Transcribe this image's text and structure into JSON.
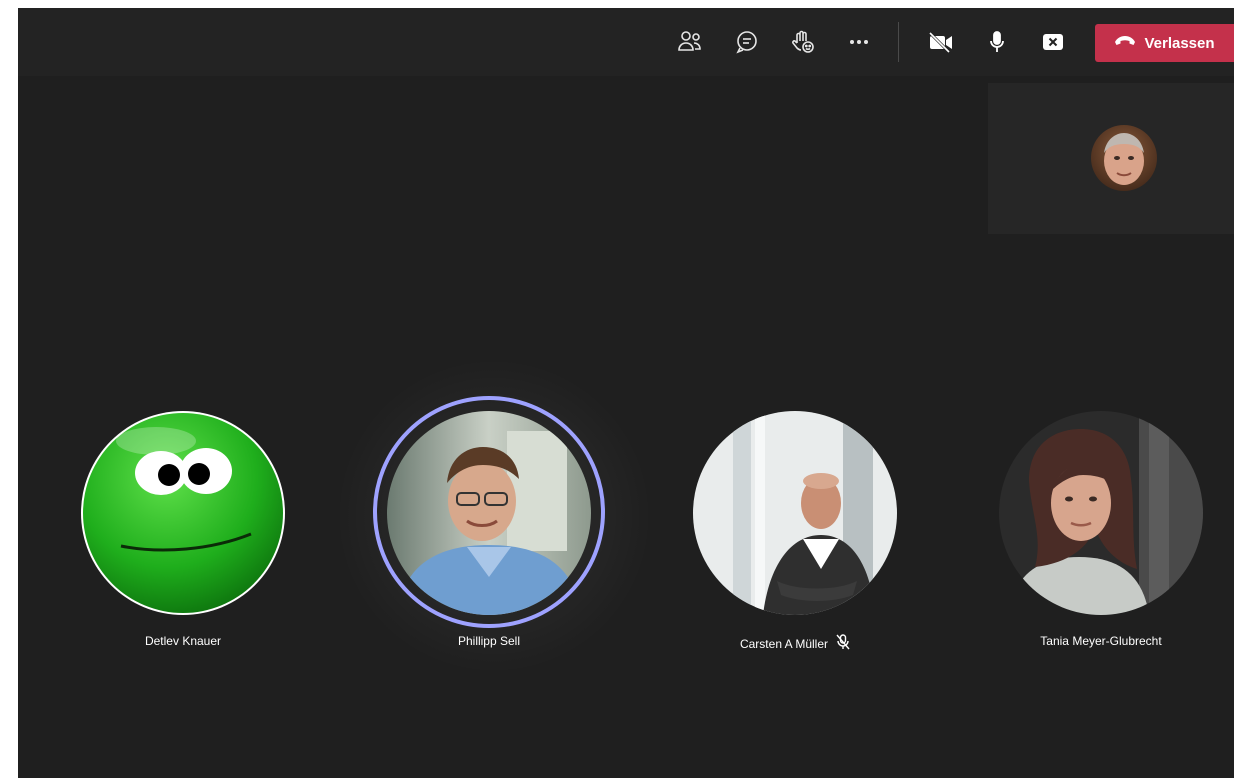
{
  "toolbar": {
    "icons": [
      "participants-icon",
      "chat-icon",
      "raise-hand-icon",
      "more-options-icon",
      "camera-off-icon",
      "microphone-icon",
      "share-tray-icon",
      "hang-up-icon"
    ],
    "leave_label": "Verlassen",
    "leave_color": "#c4314b"
  },
  "participants": [
    {
      "name": "Detlev Knauer",
      "muted": false,
      "speaking": false
    },
    {
      "name": "Phillipp Sell",
      "muted": false,
      "speaking": true
    },
    {
      "name": "Carsten A Müller",
      "muted": true,
      "speaking": false
    },
    {
      "name": "Tania Meyer-Glubrecht",
      "muted": false,
      "speaking": false
    }
  ],
  "colors": {
    "stage_background": "#1f1f1f",
    "toolbar_background": "#232323",
    "speaking_ring": "#9ea2ff"
  }
}
